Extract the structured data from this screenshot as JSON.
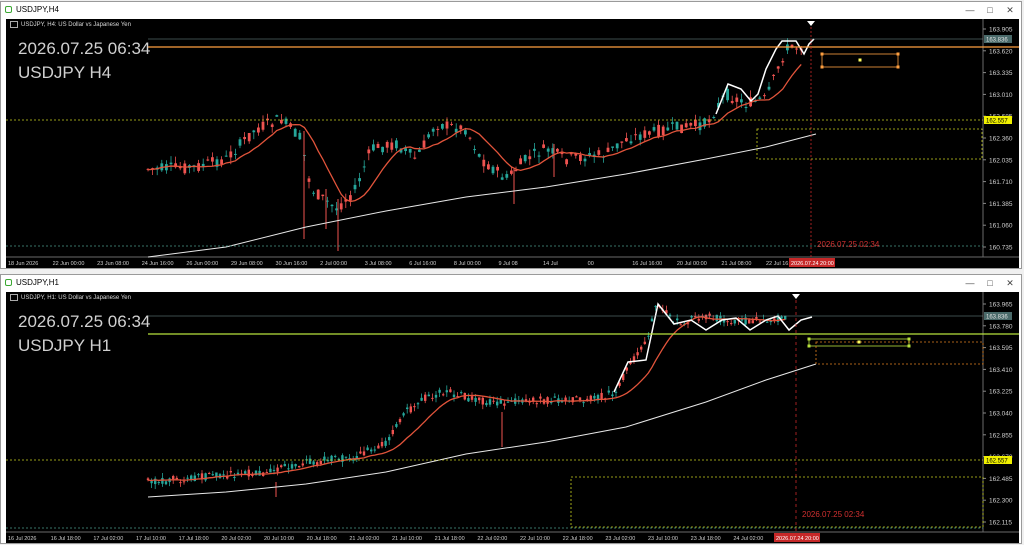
{
  "top": {
    "window_title": "USDJPY,H4",
    "symbol_line": "USDJPY, H4:  US Dollar vs Japanese Yen",
    "overlay_time": "2026.07.25 06:34",
    "overlay_symbol": "USDJPY H4",
    "prices": [
      "163.905",
      "163.620",
      "163.335",
      "163.010",
      "162.685",
      "162.360",
      "162.035",
      "161.710",
      "161.385",
      "161.060",
      "160.735"
    ],
    "current_price": "163.836",
    "line_price": "162.557",
    "dates": [
      "18 Jun 2026",
      "22 Jun 00:00",
      "23 Jun 08:00",
      "24 Jun 16:00",
      "26 Jun 00:00",
      "29 Jun 08:00",
      "30 Jun 16:00",
      "2 Jul 00:00",
      "3 Jul 08:00",
      "6 Jul 16:00",
      "8 Jul 00:00",
      "9 Jul 08",
      "14 Jul",
      "00",
      "16 Jul 16:00",
      "20 Jul 00:00",
      "21 Jul 08:00",
      "22 Jul 16:00"
    ],
    "highlight_date": "2026.07.24 20:00",
    "vline_label": "2026.07.25 02:34"
  },
  "bottom": {
    "window_title": "USDJPY,H1",
    "symbol_line": "USDJPY, H1:  US Dollar vs Japanese Yen",
    "overlay_time": "2026.07.25 06:34",
    "overlay_symbol": "USDJPY H1",
    "prices": [
      "163.965",
      "163.780",
      "163.595",
      "163.410",
      "163.225",
      "163.040",
      "162.855",
      "162.670",
      "162.485",
      "162.300",
      "162.115"
    ],
    "current_price": "163.836",
    "line_price": "162.557",
    "dates": [
      "16 Jul 2026",
      "16 Jul 18:00",
      "17 Jul 02:00",
      "17 Jul 10:00",
      "17 Jul 18:00",
      "20 Jul 02:00",
      "20 Jul 10:00",
      "20 Jul 18:00",
      "21 Jul 02:00",
      "21 Jul 10:00",
      "21 Jul 18:00",
      "22 Jul 02:00",
      "22 Jul 10:00",
      "22 Jul 18:00",
      "23 Jul 02:00",
      "23 Jul 10:00",
      "23 Jul 18:00",
      "24 Jul 02:00",
      "24 Jul 10:00"
    ],
    "highlight_date": "2026.07.24 20:00",
    "vline_label": "2026.07.25 02:34"
  },
  "colors": {
    "bull": "#26a69a",
    "bear": "#ef5350",
    "ma_fast": "#e2543b",
    "ma_slow": "#e8e8e8",
    "hline_top": "#ffa040",
    "hline_bottom": "#b7e13c",
    "dotted": "#c8d020"
  },
  "window_controls": [
    "minimize-icon",
    "maximize-icon",
    "close-icon"
  ]
}
